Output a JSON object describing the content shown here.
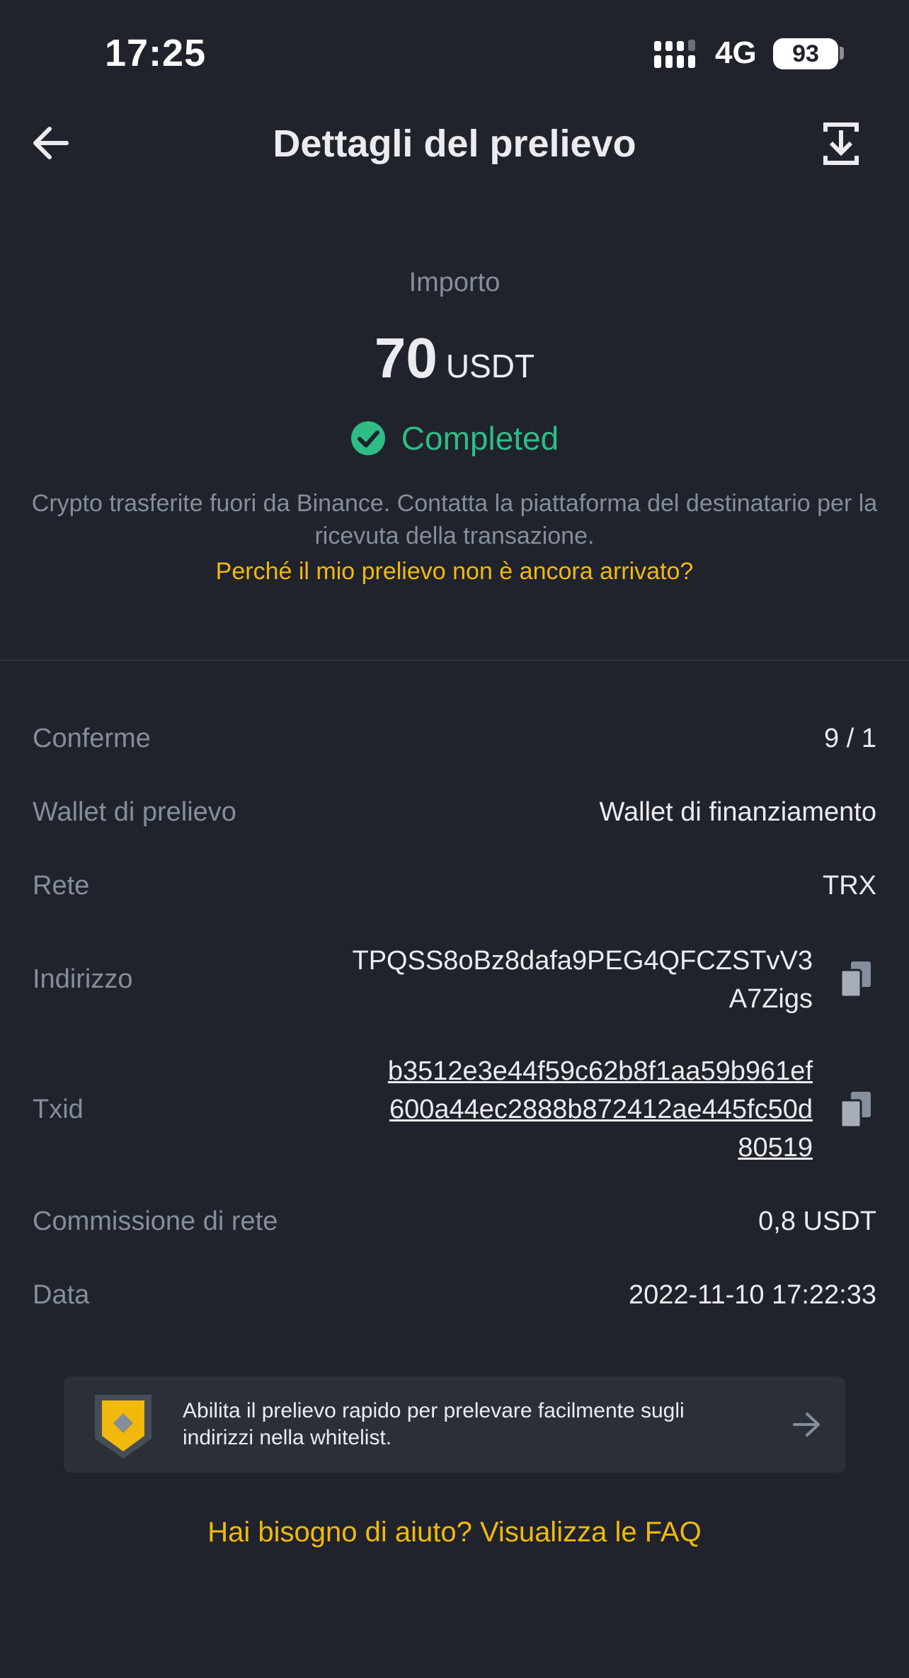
{
  "status_bar": {
    "time": "17:25",
    "network": "4G",
    "battery": "93"
  },
  "header": {
    "title": "Dettagli del prelievo"
  },
  "summary": {
    "amount_label": "Importo",
    "amount_value": "70",
    "amount_unit": "USDT",
    "status": "Completed",
    "info": "Crypto trasferite fuori da Binance. Contatta la piattaforma del destinatario per la ricevuta della transazione.",
    "why_link": "Perché il mio prelievo non è ancora arrivato?"
  },
  "details": {
    "confirms_label": "Conferme",
    "confirms_value": "9 / 1",
    "wallet_label": "Wallet di prelievo",
    "wallet_value": "Wallet di finanziamento",
    "network_label": "Rete",
    "network_value": "TRX",
    "address_label": "Indirizzo",
    "address_line1": "TPQSS8oBz8dafa9PEG4QFCZSTvV3",
    "address_line2": "A7Zigs",
    "txid_label": "Txid",
    "txid_line1": "b3512e3e44f59c62b8f1aa59b961ef",
    "txid_line2": "600a44ec2888b872412ae445fc50d",
    "txid_line3": "80519",
    "fee_label": "Commissione di rete",
    "fee_value": "0,8 USDT",
    "date_label": "Data",
    "date_value": "2022-11-10 17:22:33"
  },
  "banner": {
    "text": "Abilita il prelievo rapido per prelevare facilmente sugli indirizzi nella whitelist."
  },
  "faq_link": "Hai bisogno di aiuto? Visualizza le FAQ",
  "icons": {
    "back": "back-arrow-icon",
    "download": "download-icon",
    "status": "check-circle-icon",
    "copy": "copy-icon",
    "banner": "shield-icon",
    "banner_arrow": "arrow-right-icon"
  },
  "colors": {
    "background": "#20232b",
    "accent": "#f0b90b",
    "success": "#2ebd85",
    "muted": "#848e9c",
    "text": "#eaecef"
  }
}
